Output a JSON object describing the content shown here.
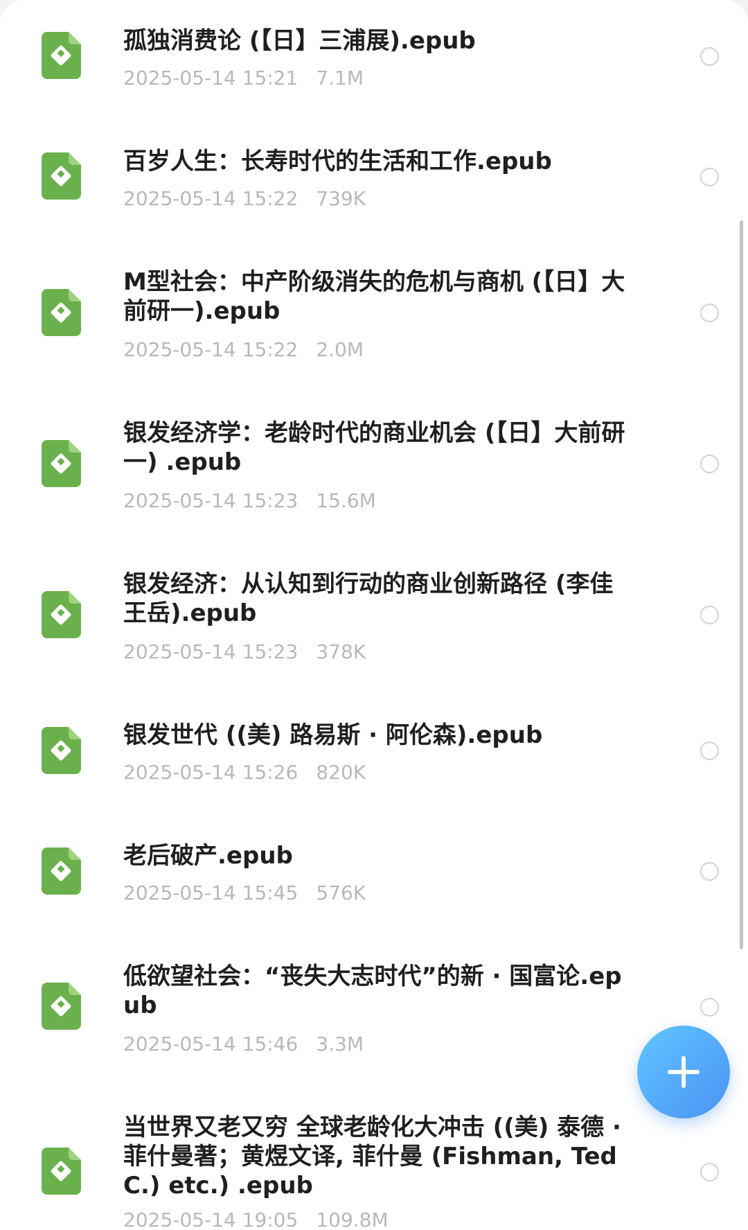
{
  "files": [
    {
      "name": "孤独消费论 (【日】三浦展).epub",
      "date": "2025-05-14 15:21",
      "size": "7.1M",
      "icon": "epub-file-icon"
    },
    {
      "name": "百岁人生：长寿时代的生活和工作.epub",
      "date": "2025-05-14 15:22",
      "size": "739K",
      "icon": "epub-file-icon"
    },
    {
      "name": "M型社会：中产阶级消失的危机与商机 (【日】大前研一).epub",
      "date": "2025-05-14 15:22",
      "size": "2.0M",
      "icon": "epub-file-icon"
    },
    {
      "name": "银发经济学：老龄时代的商业机会 (【日】大前研一) .epub",
      "date": "2025-05-14 15:23",
      "size": "15.6M",
      "icon": "epub-file-icon"
    },
    {
      "name": "银发经济：从认知到行动的商业创新路径 (李佳  王岳).epub",
      "date": "2025-05-14 15:23",
      "size": "378K",
      "icon": "epub-file-icon"
    },
    {
      "name": "银发世代 ((美) 路易斯 · 阿伦森).epub",
      "date": "2025-05-14 15:26",
      "size": "820K",
      "icon": "epub-file-icon"
    },
    {
      "name": "老后破产.epub",
      "date": "2025-05-14 15:45",
      "size": "576K",
      "icon": "epub-file-icon"
    },
    {
      "name": "低欲望社会：“丧失大志时代”的新 · 国富论.epub",
      "date": "2025-05-14 15:46",
      "size": "3.3M",
      "icon": "epub-file-icon"
    },
    {
      "name": "当世界又老又穷 全球老龄化大冲击 ((美) 泰德 · 菲什曼著；黄煜文译, 菲什曼 (Fishman, Ted C.) etc.) .epub",
      "date": "2025-05-14 19:05",
      "size": "109.8M",
      "icon": "epub-file-icon"
    }
  ],
  "fab": {
    "icon": "plus-icon"
  },
  "colors": {
    "icon_green": "#6ab04c",
    "accent_blue": "#4c92f5",
    "meta_gray": "#b8b8b8"
  }
}
